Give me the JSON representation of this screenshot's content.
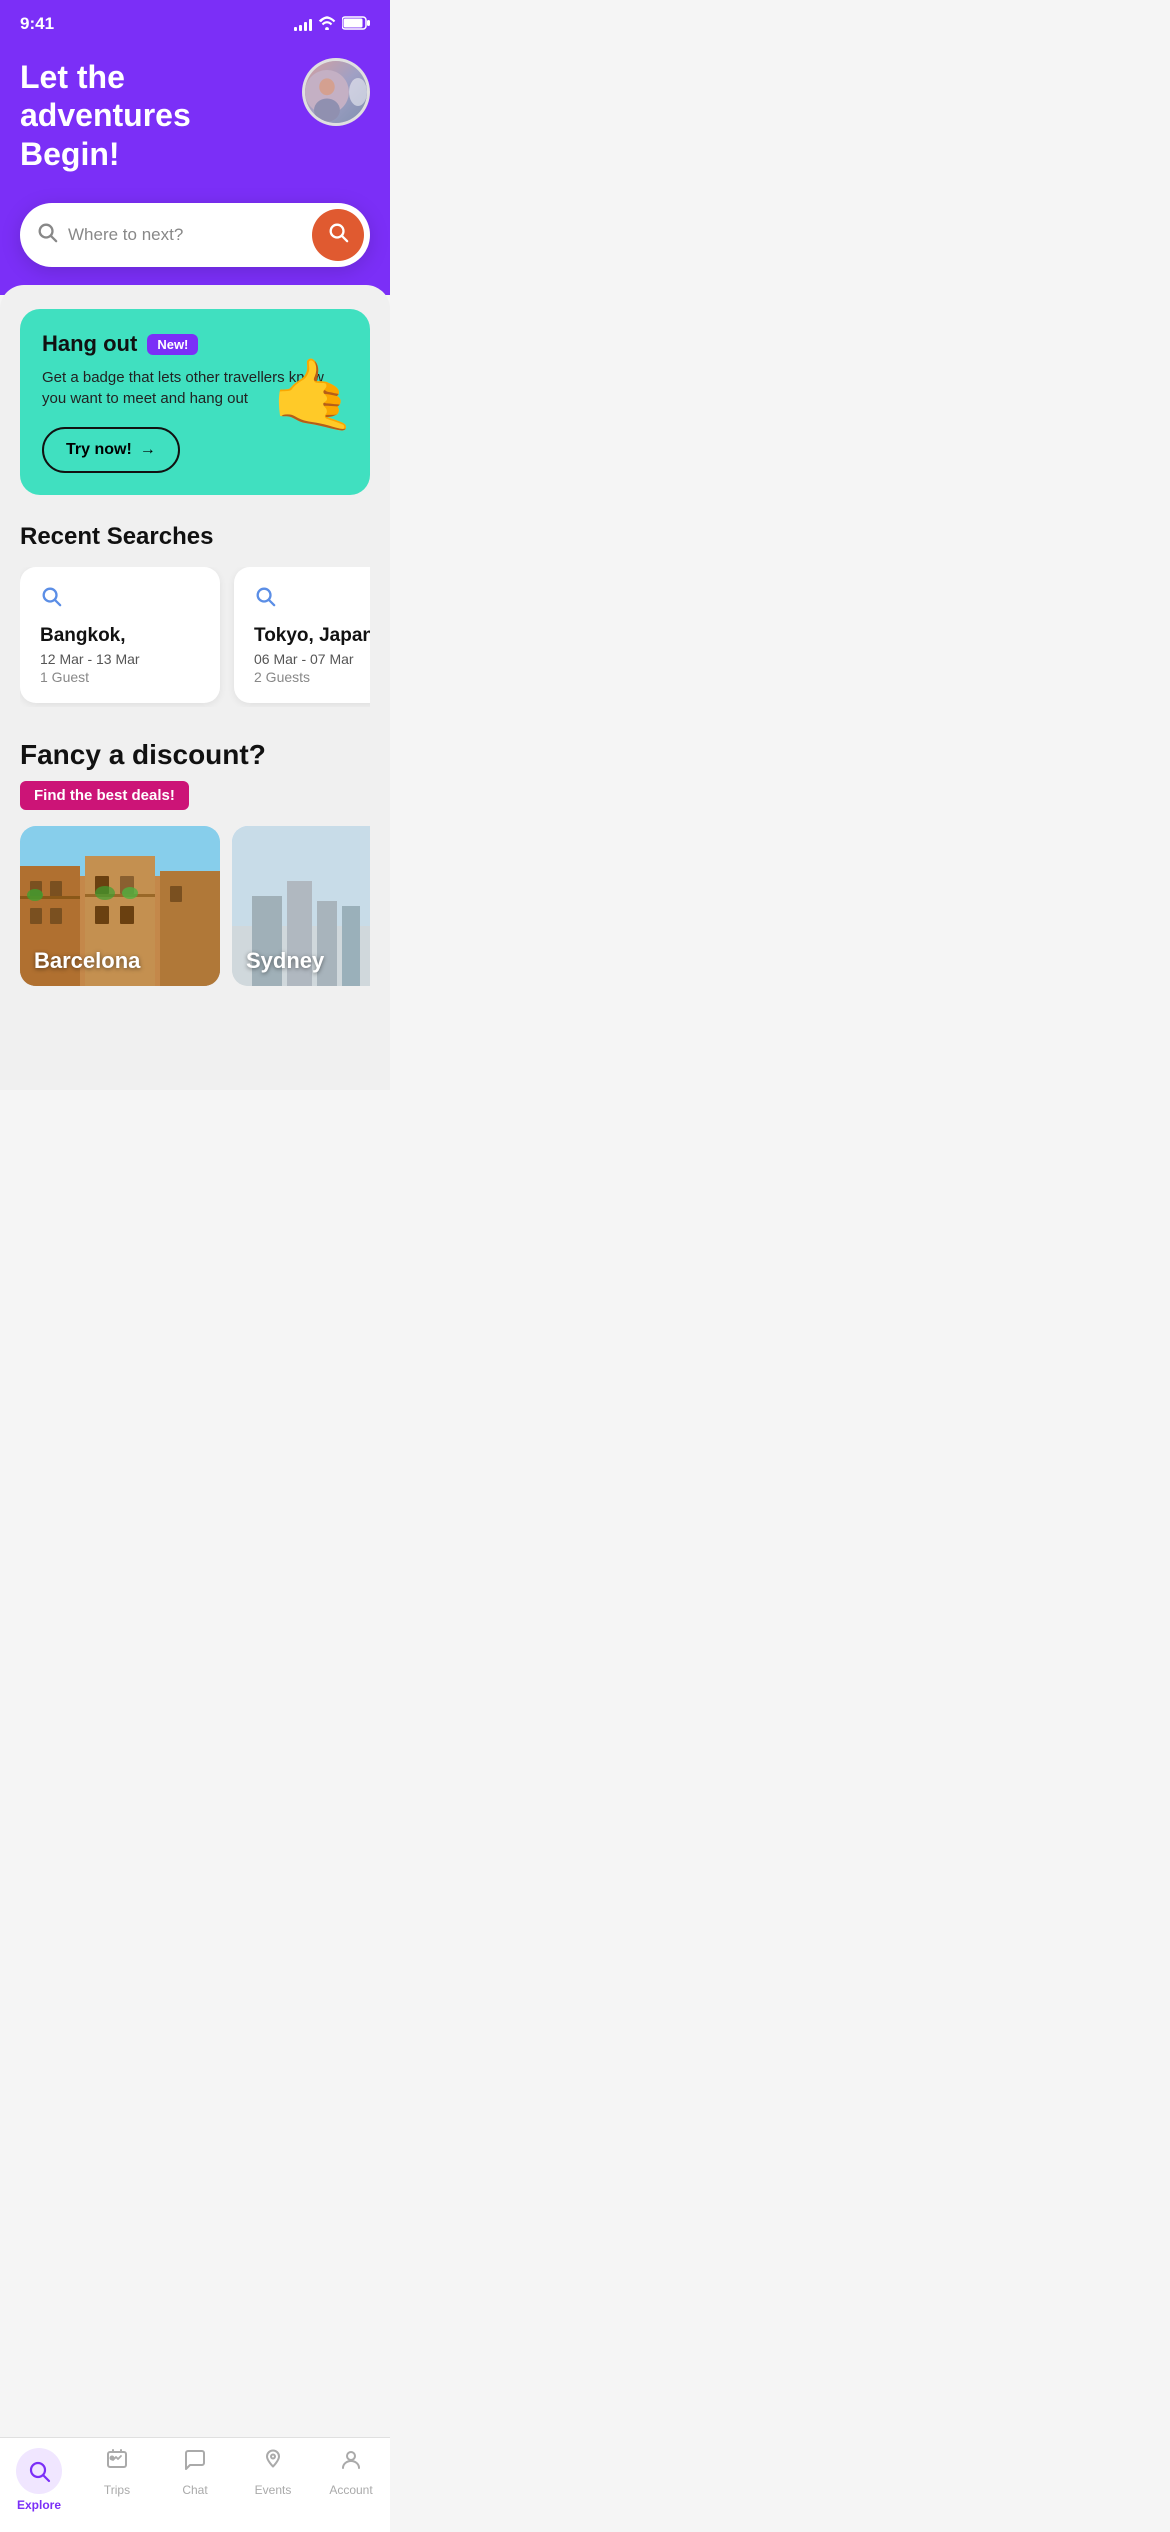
{
  "statusBar": {
    "time": "9:41"
  },
  "header": {
    "title": "Let the adventures Begin!",
    "avatarAlt": "User avatar"
  },
  "search": {
    "placeholder": "Where to next?",
    "buttonAriaLabel": "Search"
  },
  "hangoutCard": {
    "title": "Hang out",
    "badge": "New!",
    "description": "Get a badge that lets other travellers know you want to meet and hang out",
    "ctaLabel": "Try now!",
    "ctaArrow": "→",
    "emoji": "🤙"
  },
  "recentSearches": {
    "sectionTitle": "Recent Searches",
    "items": [
      {
        "city": "Bangkok,",
        "dates": "12 Mar - 13 Mar",
        "guests": "1 Guest"
      },
      {
        "city": "Tokyo, Japan",
        "dates": "06 Mar - 07 Mar",
        "guests": "2 Guests"
      }
    ]
  },
  "discountSection": {
    "title": "Fancy a discount?",
    "badgeLabel": "Find the best deals!",
    "destinations": [
      {
        "name": "Barcelona"
      },
      {
        "name": "Sydney"
      }
    ]
  },
  "bottomNav": {
    "items": [
      {
        "id": "explore",
        "label": "Explore",
        "active": true
      },
      {
        "id": "trips",
        "label": "Trips",
        "active": false
      },
      {
        "id": "chat",
        "label": "Chat",
        "active": false
      },
      {
        "id": "events",
        "label": "Events",
        "active": false
      },
      {
        "id": "account",
        "label": "Account",
        "active": false
      }
    ]
  }
}
